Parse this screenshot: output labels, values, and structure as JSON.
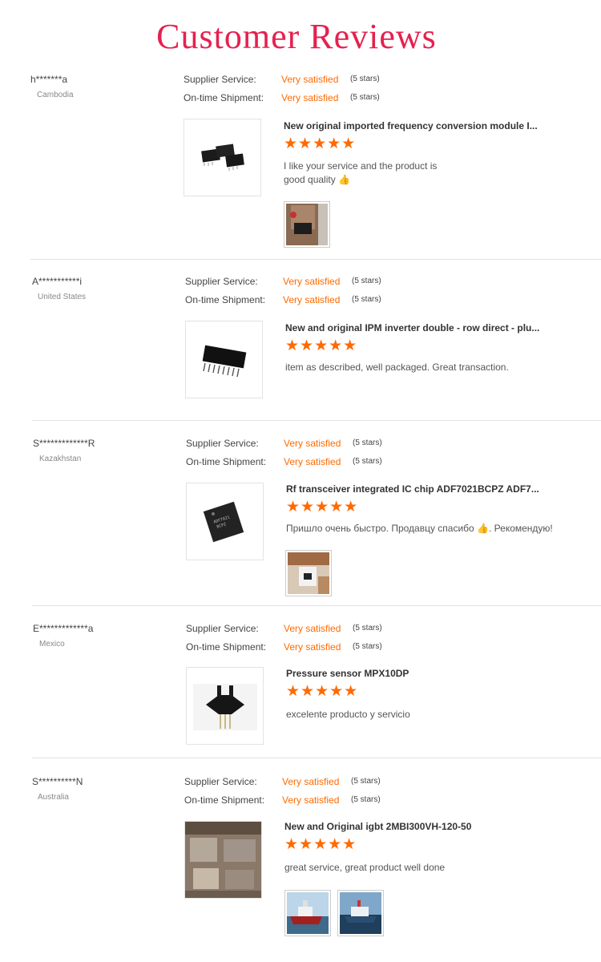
{
  "page": {
    "title": "Customer Reviews"
  },
  "labels": {
    "supplier_service": "Supplier Service:",
    "shipment": "On-time Shipment:",
    "rating_value": "Very satisfied",
    "rating_stars": "(5 stars)"
  },
  "reviews": [
    {
      "user": "h*******a",
      "country": "Cambodia",
      "product": "New original imported frequency conversion module I...",
      "stars": "★★★★★",
      "text": "I like your service and the product is good quality 👍"
    },
    {
      "user": "A***********i",
      "country": "United States",
      "product": "New and original IPM inverter double - row direct - plu...",
      "stars": "★★★★★",
      "text": "item as described, well packaged. Great transaction."
    },
    {
      "user": "S*************R",
      "country": "Kazakhstan",
      "product": "Rf transceiver integrated IC chip ADF7021BCPZ ADF7...",
      "stars": "★★★★★",
      "text": "Пришло очень быстро.  Продавцу спасибо 👍. Рекомендую!"
    },
    {
      "user": "E*************a",
      "country": "Mexico",
      "product": "Pressure sensor MPX10DP",
      "stars": "★★★★★",
      "text": "excelente producto y servicio"
    },
    {
      "user": "S**********N",
      "country": "Australia",
      "product": "New and Original igbt 2MBI300VH-120-50",
      "stars": "★★★★★",
      "text": "great service, great product well done"
    }
  ]
}
